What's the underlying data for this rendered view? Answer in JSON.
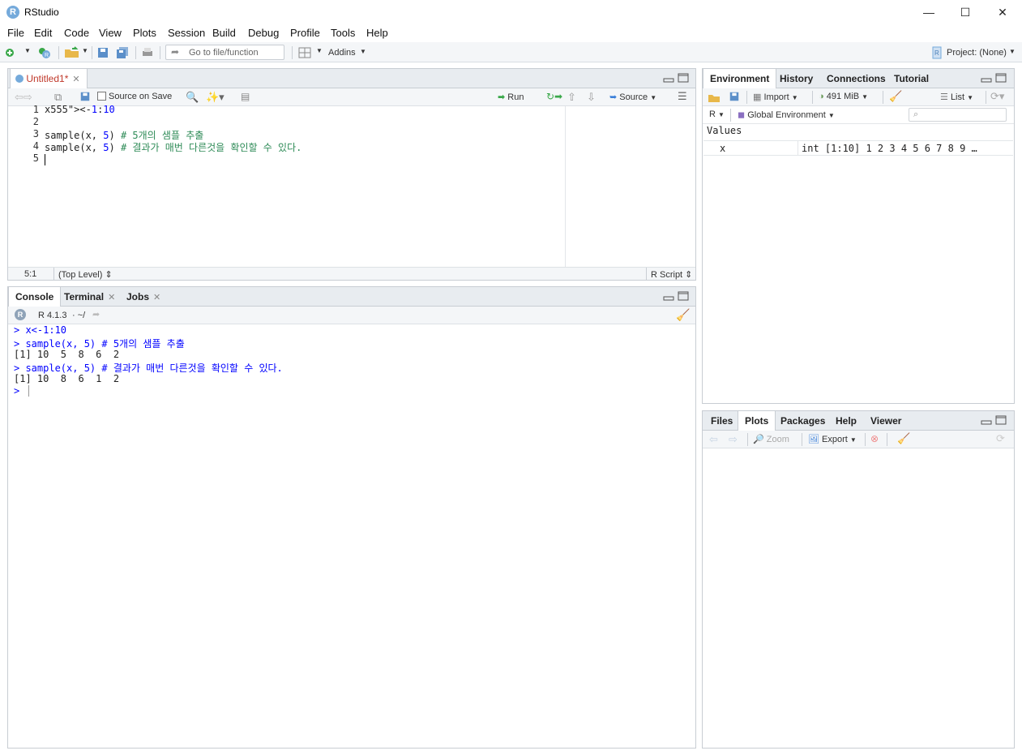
{
  "window": {
    "title": "RStudio",
    "minimize": "—",
    "maximize": "☐",
    "close": "✕"
  },
  "menu": [
    "File",
    "Edit",
    "Code",
    "View",
    "Plots",
    "Session",
    "Build",
    "Debug",
    "Profile",
    "Tools",
    "Help"
  ],
  "toolbar": {
    "goto_placeholder": "Go to file/function",
    "addins": "Addins",
    "project": "Project: (None)"
  },
  "editor": {
    "tab_title": "Untitled1*",
    "source_on_save": "Source on Save",
    "run": "Run",
    "source": "Source",
    "lines": [
      {
        "n": "1",
        "code": "x<-1:10"
      },
      {
        "n": "2",
        "code": ""
      },
      {
        "n": "3",
        "code": "sample(x, 5) # 5개의 샘플 추출"
      },
      {
        "n": "4",
        "code": "sample(x, 5) # 결과가 매번 다른것을 확인할 수 있다."
      },
      {
        "n": "5",
        "code": ""
      }
    ],
    "status_pos": "5:1",
    "status_scope": "(Top Level) ⇕",
    "status_type": "R Script ⇕"
  },
  "console": {
    "tabs": [
      "Console",
      "Terminal",
      "Jobs"
    ],
    "version": "R 4.1.3",
    "path": "· ~/",
    "lines": [
      {
        "text": "> x<-1:10",
        "kind": "input"
      },
      {
        "text": "> sample(x, 5) # 5개의 샘플 추출",
        "kind": "input"
      },
      {
        "text": "[1] 10  5  8  6  2",
        "kind": "output"
      },
      {
        "text": "> sample(x, 5) # 결과가 매번 다른것을 확인할 수 있다.",
        "kind": "input"
      },
      {
        "text": "[1] 10  8  6  1  2",
        "kind": "output"
      },
      {
        "text": ">",
        "kind": "input"
      }
    ]
  },
  "environment": {
    "tabs": [
      "Environment",
      "History",
      "Connections",
      "Tutorial"
    ],
    "import": "Import",
    "memory": "491 MiB",
    "list": "List",
    "lang": "R",
    "scope": "Global Environment",
    "section": "Values",
    "rows": [
      {
        "name": "x",
        "value": "int [1:10] 1 2 3 4 5 6 7 8 9 …"
      }
    ]
  },
  "files": {
    "tabs": [
      "Files",
      "Plots",
      "Packages",
      "Help",
      "Viewer"
    ],
    "zoom": "Zoom",
    "export": "Export"
  },
  "colors": {
    "accent": "#75aadb",
    "keyword_blue": "#0000ff",
    "comment": "#2e8b57",
    "tab_bg": "#e8ecf0",
    "border": "#c8cdd3"
  }
}
